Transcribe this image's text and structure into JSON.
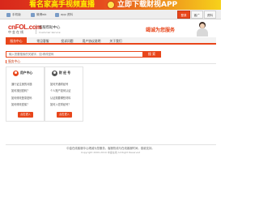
{
  "banner": {
    "text_left": "看名家高手视频直播",
    "text_right": "立即下载财视APP"
  },
  "topbar": {
    "links": [
      {
        "label": "手机版",
        "icon": "phone-icon"
      },
      {
        "label": "微博wb",
        "icon": "weibo-icon"
      },
      {
        "label": "app 资料",
        "icon": "app-icon"
      }
    ],
    "right_buttons": [
      "登录",
      "客广",
      "资料"
    ]
  },
  "header": {
    "logo_top": "cnFOL.com",
    "logo_bottom": "中金在线",
    "service_title": "客服帮助中心",
    "service_subtitle": "Customer Service",
    "slogan": "竭诚为您服务"
  },
  "nav": {
    "items": [
      "服务中心",
      "常见客服",
      "投诉问题",
      "用户协议说明",
      "关于我们"
    ],
    "active_index": 0
  },
  "search": {
    "placeholder": "输入您要搜索的关键字，如:修改密码",
    "button_label": "搜 索"
  },
  "section": {
    "title": "服务中心"
  },
  "cards": [
    {
      "title": "用户中心",
      "icon": "user-center-icon",
      "items": [
        "通行证注册的问题",
        "如何找回密码？",
        "如何修改登录密码",
        "如何修改密保？"
      ],
      "button_label": "点击进入"
    },
    {
      "title": "财 经 号",
      "icon": "finance-account-icon",
      "items": [
        "如何开通财经号",
        "个人账户如何认证",
        "认证需要哪些材料",
        "如何入驻财经号？"
      ],
      "button_label": "点击进入"
    }
  ],
  "footer": {
    "line1": "中金在线客服中心竭诚为您服务，客服热线与在线客服时间，感谢支持。",
    "line2": "Copyright 2000-2019 中金在线 All Right Reserved"
  },
  "colors": {
    "accent": "#e8461b",
    "banner_start": "#d8281b",
    "banner_end": "#f6d21b"
  }
}
